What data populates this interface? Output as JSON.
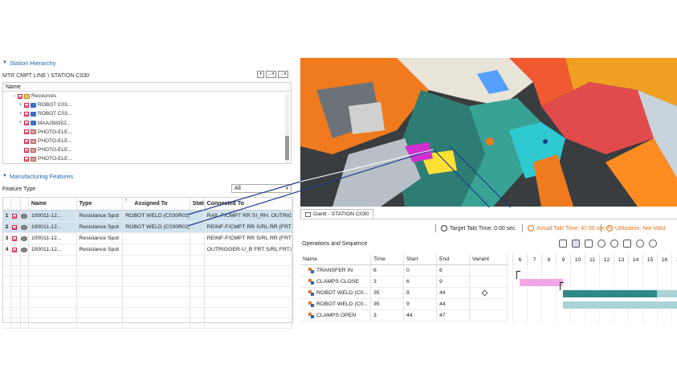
{
  "station_hierarchy": {
    "title": "Station Hierarchy",
    "path": "MTR CMPT LINE \\ STATION C030",
    "name_header": "Name",
    "nav_buttons": [
      "▾",
      "←▾",
      "→▾"
    ],
    "items": [
      {
        "label": "Resources",
        "icon": "folder-icon",
        "expand": "−"
      },
      {
        "label": "ROBOT C03...",
        "icon": "robot-icon",
        "expand": "+"
      },
      {
        "label": "ROBOT C03...",
        "icon": "robot-icon",
        "expand": "+"
      },
      {
        "label": "MAA288352...",
        "icon": "robot-icon",
        "expand": "+"
      },
      {
        "label": "PHOTO-ELE...",
        "icon": "sensor-icon",
        "expand": ""
      },
      {
        "label": "PHOTO-ELE...",
        "icon": "sensor-icon",
        "expand": ""
      },
      {
        "label": "PHOTO-ELE...",
        "icon": "sensor-icon",
        "expand": ""
      },
      {
        "label": "PHOTO-ELE...",
        "icon": "sensor-icon",
        "expand": ""
      }
    ]
  },
  "manufacturing_features": {
    "title": "Manufacturing Features",
    "filter_label": "Feature Type",
    "filter_value": "All",
    "columns": [
      "",
      "",
      "",
      "Name",
      "Type",
      "Assigned To",
      "Statu",
      "Connected To"
    ],
    "sort_indicator": "↑",
    "rows": [
      {
        "num": "1",
        "name": "100011-12...",
        "type": "Resistance Spot",
        "assigned": "ROBOT WELD (C030R01)",
        "status": "",
        "connected": "RAIL-F/CMPT RR SI_RH, OUTRIGG"
      },
      {
        "num": "2",
        "name": "100011-12...",
        "type": "Resistance Spot",
        "assigned": "ROBOT WELD (C030R01)",
        "status": "",
        "connected": "REINF-F/CMPT RR S/RL RR (FRT),"
      },
      {
        "num": "3",
        "name": "100011-12...",
        "type": "Resistance Spot",
        "assigned": "",
        "status": "",
        "connected": "REINF-F/CMPT RR S/RL RR (FRT),L"
      },
      {
        "num": "4",
        "name": "100011-12...",
        "type": "Resistance Spot",
        "assigned": "",
        "status": "",
        "connected": "OUTRIGGER-U_B FRT S/RL FRT,LH"
      }
    ]
  },
  "gantt": {
    "tab_label": "Gantt - STATION C030",
    "target_takt": "Target Takt Time: 0.00 sec",
    "actual_takt": "Actual Takt Time: 47.00 sec",
    "utilization": "Utilization: Not Valid",
    "operations_label": "Operations and Sequence",
    "columns": [
      "Name",
      "Time",
      "Start",
      "End",
      "Variant"
    ],
    "rows": [
      {
        "name": "TRANSFER IN",
        "time": "6",
        "start": "0",
        "end": "6",
        "variant": ""
      },
      {
        "name": "CLAMPS CLOSE",
        "time": "3",
        "start": "6",
        "end": "9",
        "variant": ""
      },
      {
        "name": "ROBOT WELD (C0...",
        "time": "35",
        "start": "9",
        "end": "44",
        "variant": "cube-icon"
      },
      {
        "name": "ROBOT WELD (C0...",
        "time": "35",
        "start": "9",
        "end": "44",
        "variant": ""
      },
      {
        "name": "CLAMPS OPEN",
        "time": "3",
        "start": "44",
        "end": "47",
        "variant": ""
      }
    ],
    "timeline_ticks": [
      "6",
      "7",
      "8",
      "9",
      "10",
      "11",
      "12",
      "13",
      "14",
      "15",
      "16",
      "17"
    ],
    "colors": {
      "clamps_close": "#f2a6e6",
      "robot_weld_dark": "#2e8a88",
      "robot_weld_light": "#a9d3d6",
      "actual_takt": "#e0701a"
    }
  }
}
